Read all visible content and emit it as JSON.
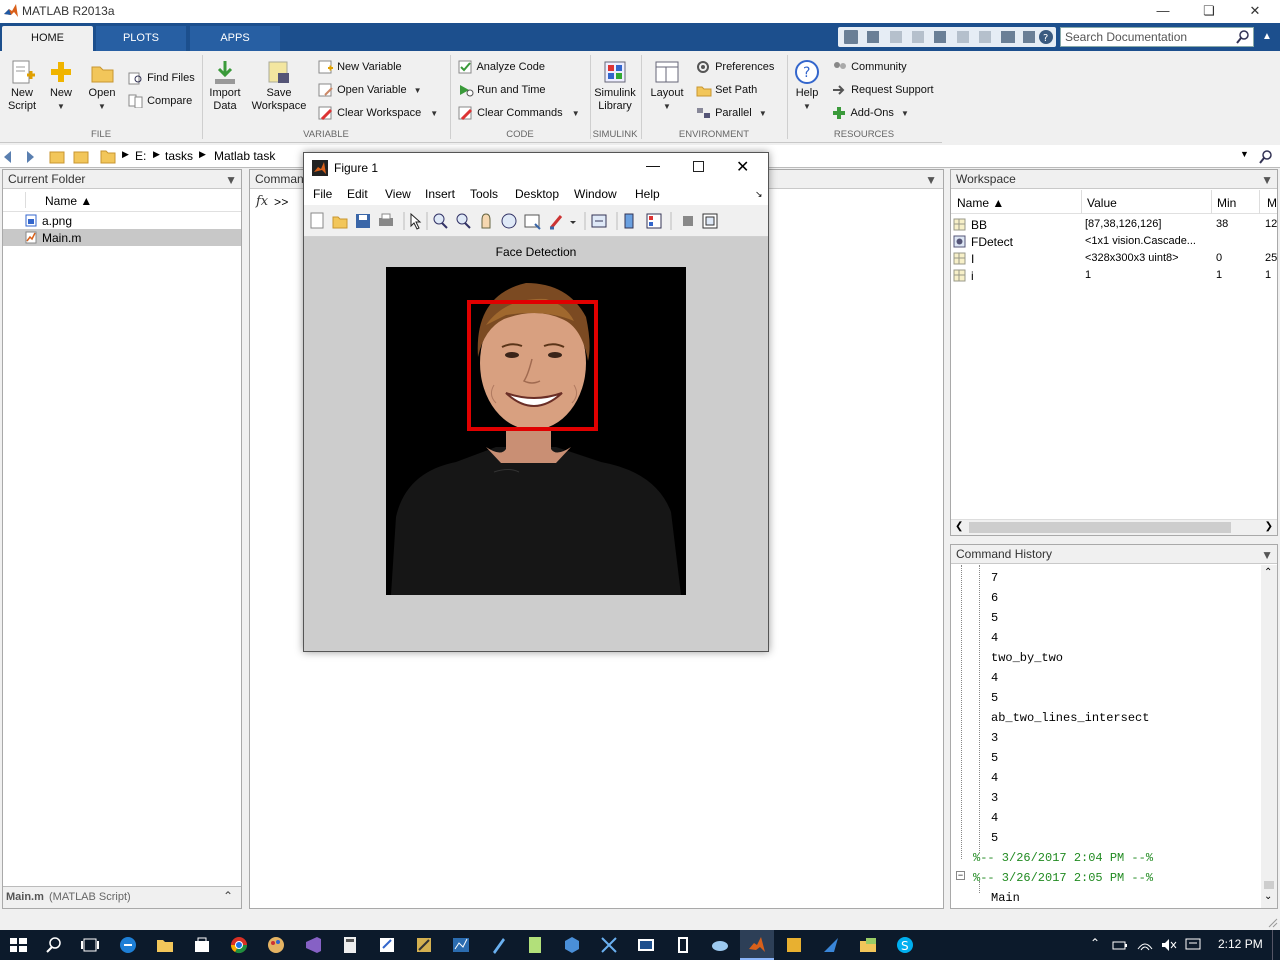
{
  "app": {
    "title": "MATLAB R2013a"
  },
  "ribbon": {
    "tabs": [
      "HOME",
      "PLOTS",
      "APPS"
    ],
    "search_placeholder": "Search Documentation",
    "file": {
      "new_script": [
        "New",
        "Script"
      ],
      "new": "New",
      "open": "Open",
      "find_files": "Find Files",
      "compare": "Compare",
      "label": "FILE"
    },
    "variable": {
      "import_data": [
        "Import",
        "Data"
      ],
      "save_workspace": [
        "Save",
        "Workspace"
      ],
      "new_variable": "New Variable",
      "open_variable": "Open Variable",
      "clear_workspace": "Clear Workspace",
      "label": "VARIABLE"
    },
    "code": {
      "analyze_code": "Analyze Code",
      "run_and_time": "Run and Time",
      "clear_commands": "Clear Commands",
      "label": "CODE"
    },
    "simulink": {
      "library": [
        "Simulink",
        "Library"
      ],
      "label": "SIMULINK"
    },
    "environment": {
      "layout": "Layout",
      "preferences": "Preferences",
      "set_path": "Set Path",
      "parallel": "Parallel",
      "label": "ENVIRONMENT"
    },
    "resources": {
      "help": "Help",
      "community": "Community",
      "request_support": "Request Support",
      "add_ons": "Add-Ons",
      "label": "RESOURCES"
    }
  },
  "address": {
    "path": [
      "E:",
      "tasks",
      "Matlab task"
    ]
  },
  "current_folder": {
    "title": "Current Folder",
    "column": "Name ▲",
    "files": [
      {
        "name": "a.png",
        "icon": "image-file-icon"
      },
      {
        "name": "Main.m",
        "icon": "m-file-icon"
      }
    ],
    "details": {
      "name": "Main.m",
      "type": "(MATLAB Script)"
    }
  },
  "command_window": {
    "title": "Command Window",
    "title_visible": "Comman",
    "prompt": ">>",
    "fx": "fx"
  },
  "figure": {
    "title": "Figure 1",
    "menu": [
      "File",
      "Edit",
      "Insert",
      "Tools",
      "Desktop",
      "Window",
      "Help"
    ],
    "menu_full": [
      "File",
      "Edit",
      "View",
      "Insert",
      "Tools",
      "Desktop",
      "Window",
      "Help"
    ],
    "axes_title": "Face Detection",
    "box_color": "#e00000"
  },
  "workspace": {
    "title": "Workspace",
    "columns": [
      "Name ▲",
      "Value",
      "Min",
      "M"
    ],
    "rows": [
      {
        "name": "BB",
        "value": "[87,38,126,126]",
        "min": "38",
        "max": "12"
      },
      {
        "name": "FDetect",
        "value": "<1x1 vision.Cascade...",
        "min": "",
        "max": ""
      },
      {
        "name": "I",
        "value": "<328x300x3 uint8>",
        "min": "0",
        "max": "25"
      },
      {
        "name": "i",
        "value": "1",
        "min": "1",
        "max": "1"
      }
    ]
  },
  "command_history": {
    "title": "Command History",
    "lines": [
      "7",
      "6",
      "5",
      "4",
      "two_by_two",
      "4",
      "5",
      "ab_two_lines_intersect",
      "3",
      "5",
      "4",
      "3",
      "4",
      "5"
    ],
    "sessions": [
      "%-- 3/26/2017 2:04 PM --%",
      "%-- 3/26/2017 2:05 PM --%"
    ],
    "last": "Main"
  },
  "taskbar": {
    "time": "2:12 PM"
  }
}
